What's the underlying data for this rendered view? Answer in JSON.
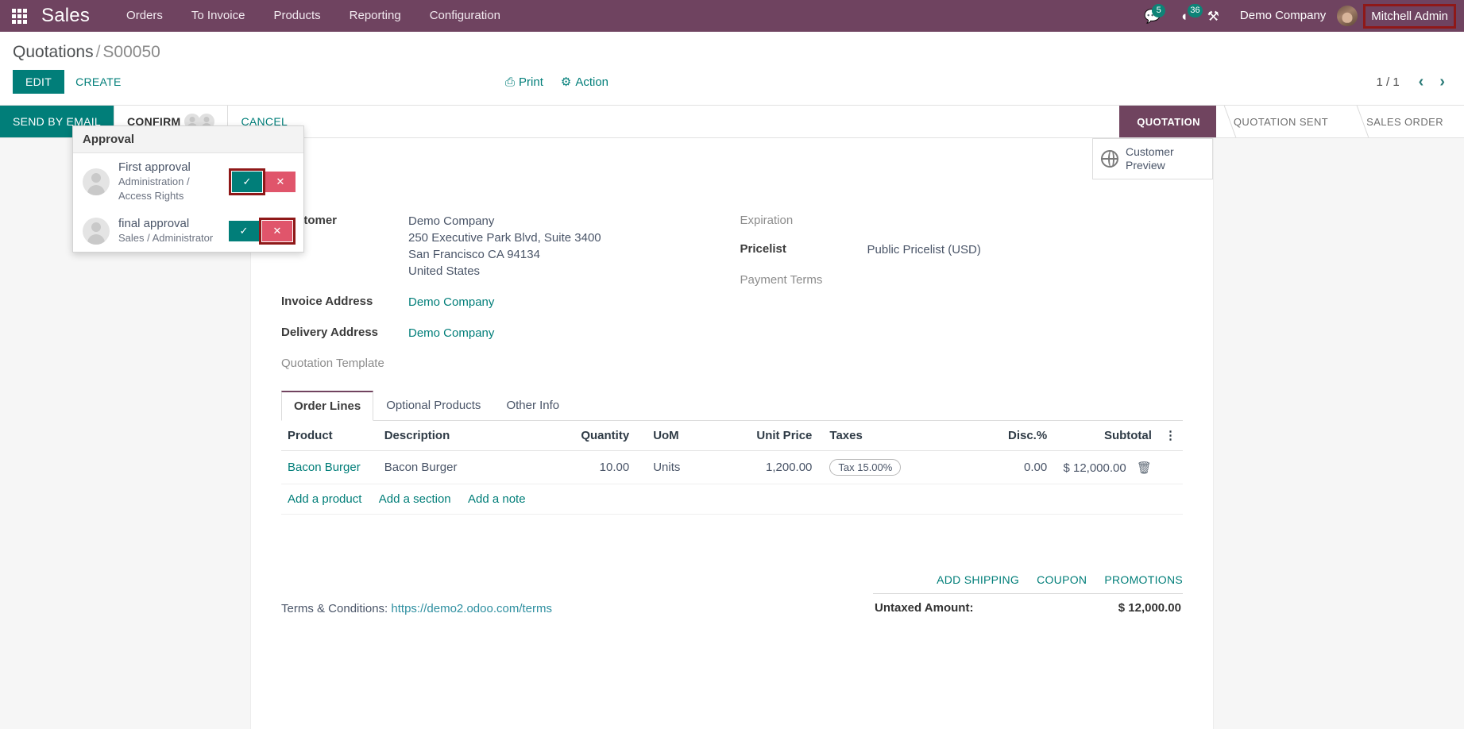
{
  "navbar": {
    "apps_icon": "apps-grid-icon",
    "brand": "Sales",
    "menus": [
      "Orders",
      "To Invoice",
      "Products",
      "Reporting",
      "Configuration"
    ],
    "messages_icon": "chat-icon",
    "messages_count": "5",
    "activities_icon": "clock-icon",
    "activities_count": "36",
    "debug_icon": "wrench-icon",
    "company": "Demo Company",
    "user": "Mitchell Admin",
    "avatar_icon": "user-avatar"
  },
  "breadcrumb": {
    "parent": "Quotations",
    "separator": "/",
    "current": "S00050"
  },
  "control_panel": {
    "edit": "EDIT",
    "create": "CREATE",
    "print": "Print",
    "print_icon": "printer-icon",
    "action": "Action",
    "action_icon": "gear-icon",
    "pager": "1 / 1",
    "prev_icon": "chevron-left-icon",
    "next_icon": "chevron-right-icon"
  },
  "statusbar": {
    "send_by_email": "SEND BY EMAIL",
    "confirm": "CONFIRM",
    "cancel": "CANCEL",
    "steps": [
      "QUOTATION",
      "QUOTATION SENT",
      "SALES ORDER"
    ],
    "active_step": "QUOTATION"
  },
  "approval_popover": {
    "title": "Approval",
    "approve_icon": "check-icon",
    "reject_icon": "x-icon",
    "rows": [
      {
        "name": "First approval",
        "group": "Administration / Access Rights",
        "avatar_icon": "user-avatar",
        "approve_highlighted": true,
        "reject_highlighted": false
      },
      {
        "name": "final approval",
        "group": "Sales / Administrator",
        "avatar_icon": "user-avatar",
        "approve_highlighted": false,
        "reject_highlighted": true
      }
    ]
  },
  "customer_preview": {
    "icon": "globe-icon",
    "line1": "Customer",
    "line2": "Preview"
  },
  "form": {
    "left": {
      "customer_label": "Customer",
      "customer_value": "Demo Company",
      "address_line1": "250 Executive Park Blvd, Suite 3400",
      "address_line2": "San Francisco CA 94134",
      "address_line3": "United States",
      "invoice_address_label": "Invoice Address",
      "invoice_address_value": "Demo Company",
      "delivery_address_label": "Delivery Address",
      "delivery_address_value": "Demo Company",
      "quotation_template_label": "Quotation Template",
      "quotation_template_value": ""
    },
    "right": {
      "expiration_label": "Expiration",
      "expiration_value": "",
      "pricelist_label": "Pricelist",
      "pricelist_value": "Public Pricelist (USD)",
      "payment_terms_label": "Payment Terms",
      "payment_terms_value": ""
    }
  },
  "notebook": {
    "tabs": [
      "Order Lines",
      "Optional Products",
      "Other Info"
    ],
    "active_tab": "Order Lines"
  },
  "order_lines": {
    "columns": [
      "Product",
      "Description",
      "Quantity",
      "UoM",
      "Unit Price",
      "Taxes",
      "Disc.%",
      "Subtotal"
    ],
    "options_icon": "vertical-dots-icon",
    "rows": [
      {
        "product": "Bacon Burger",
        "description": "Bacon Burger",
        "quantity": "10.00",
        "uom": "Units",
        "unit_price": "1,200.00",
        "taxes": "Tax 15.00%",
        "discount": "0.00",
        "subtotal": "$ 12,000.00",
        "delete_icon": "trash-icon"
      }
    ],
    "add_product": "Add a product",
    "add_section": "Add a section",
    "add_note": "Add a note"
  },
  "footer": {
    "terms_label": "Terms & Conditions:",
    "terms_url": "https://demo2.odoo.com/terms",
    "add_shipping": "ADD SHIPPING",
    "coupon": "COUPON",
    "promotions": "PROMOTIONS",
    "untaxed_label": "Untaxed Amount:",
    "untaxed_value": "$ 12,000.00"
  },
  "colors": {
    "brand_purple": "#70445f",
    "teal": "#017e79",
    "highlight_red": "#8f1818",
    "reject_red": "#e0556b"
  }
}
